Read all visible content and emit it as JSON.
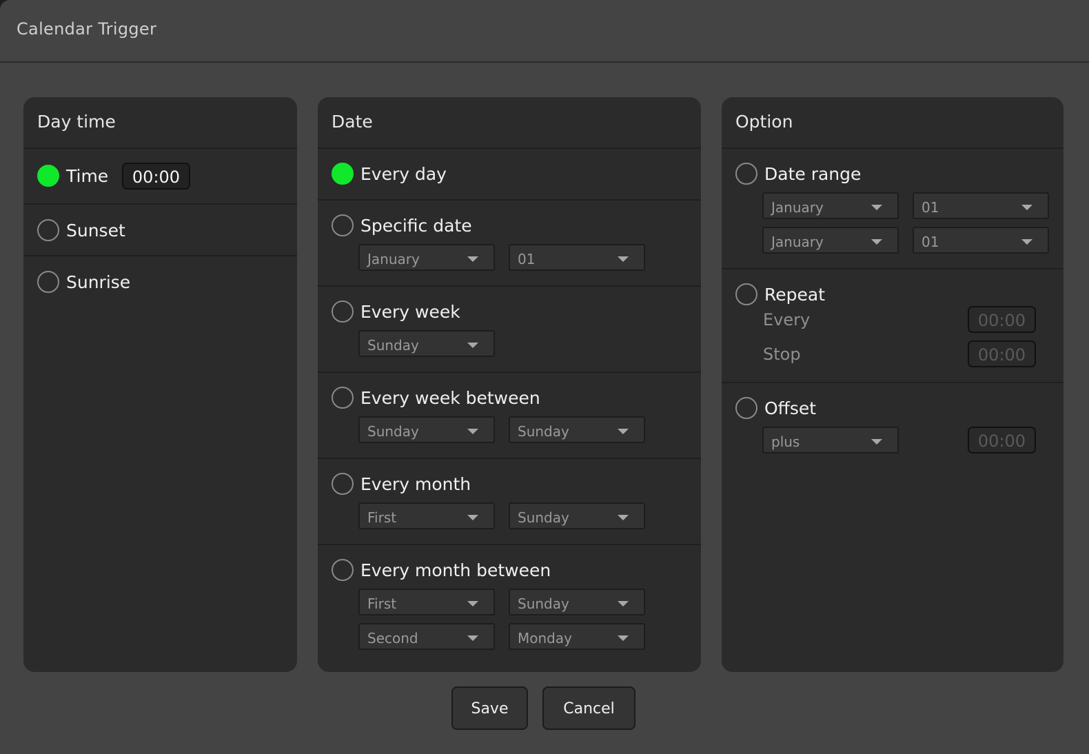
{
  "dialog": {
    "title": "Calendar Trigger"
  },
  "daytime": {
    "header": "Day time",
    "options": [
      {
        "label": "Time",
        "selected": true,
        "value": "00:00"
      },
      {
        "label": "Sunset",
        "selected": false
      },
      {
        "label": "Sunrise",
        "selected": false
      }
    ]
  },
  "date": {
    "header": "Date",
    "options": [
      {
        "label": "Every day",
        "selected": true
      },
      {
        "label": "Specific date",
        "selected": false,
        "selects": [
          "January",
          "01"
        ]
      },
      {
        "label": "Every week",
        "selected": false,
        "selects": [
          "Sunday"
        ]
      },
      {
        "label": "Every week between",
        "selected": false,
        "selects": [
          "Sunday",
          "Sunday"
        ]
      },
      {
        "label": "Every month",
        "selected": false,
        "selects": [
          "First",
          "Sunday"
        ]
      },
      {
        "label": "Every month between",
        "selected": false,
        "selects": [
          "First",
          "Sunday",
          "Second",
          "Monday"
        ]
      }
    ]
  },
  "option": {
    "header": "Option",
    "date_range": {
      "label": "Date range",
      "selected": false,
      "selects": [
        "January",
        "01",
        "January",
        "01"
      ]
    },
    "repeat": {
      "label": "Repeat",
      "selected": false,
      "every_label": "Every",
      "every_value": "00:00",
      "stop_label": "Stop",
      "stop_value": "00:00"
    },
    "offset": {
      "label": "Offset",
      "selected": false,
      "mode": "plus",
      "value": "00:00"
    }
  },
  "buttons": {
    "save": "Save",
    "cancel": "Cancel"
  },
  "colors": {
    "accent_selected": "#0fe82b",
    "panel_bg": "#2b2b2b",
    "dialog_bg": "#444444"
  }
}
